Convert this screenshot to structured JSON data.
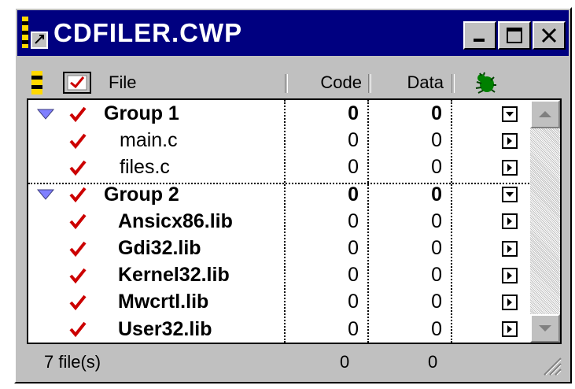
{
  "window": {
    "title": "CDFILER.CWP"
  },
  "titlebar_buttons": [
    "minimize",
    "maximize",
    "close"
  ],
  "columns": {
    "file": "File",
    "code": "Code",
    "data": "Data",
    "debug_icon": "bug-icon"
  },
  "rows": [
    {
      "type": "group",
      "name": "Group 1",
      "code": "0",
      "data": "0",
      "marker": "dropdown"
    },
    {
      "type": "file",
      "name": "main.c",
      "code": "0",
      "data": "0",
      "marker": "right"
    },
    {
      "type": "file",
      "name": "files.c",
      "code": "0",
      "data": "0",
      "marker": "right"
    },
    {
      "type": "group",
      "name": "Group 2",
      "code": "0",
      "data": "0",
      "marker": "dropdown"
    },
    {
      "type": "lib",
      "name": "Ansicx86.lib",
      "code": "0",
      "data": "0",
      "marker": "right"
    },
    {
      "type": "lib",
      "name": "Gdi32.lib",
      "code": "0",
      "data": "0",
      "marker": "right"
    },
    {
      "type": "lib",
      "name": "Kernel32.lib",
      "code": "0",
      "data": "0",
      "marker": "right"
    },
    {
      "type": "lib",
      "name": "Mwcrtl.lib",
      "code": "0",
      "data": "0",
      "marker": "right"
    },
    {
      "type": "lib",
      "name": "User32.lib",
      "code": "0",
      "data": "0",
      "marker": "right"
    }
  ],
  "status": {
    "files": "7 file(s)",
    "code_total": "0",
    "data_total": "0"
  },
  "colors": {
    "title_bar": "#000080",
    "checkmark": "#cc0000",
    "group_triangle": "#8080ff"
  }
}
